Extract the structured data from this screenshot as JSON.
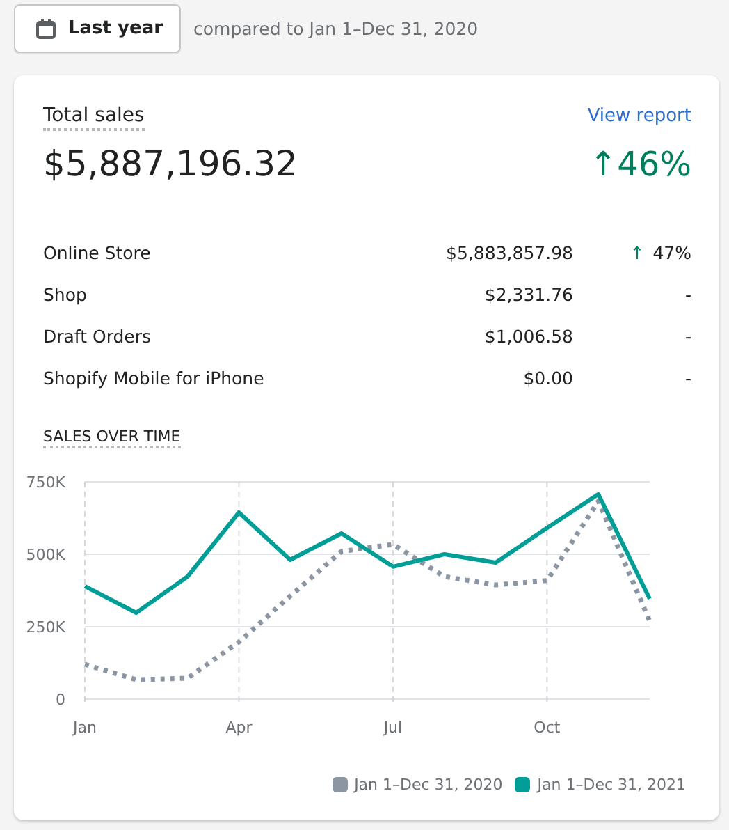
{
  "date_button": {
    "label": "Last year"
  },
  "comparison": "compared to Jan 1–Dec 31, 2020",
  "card": {
    "title": "Total sales",
    "link": "View report",
    "total": "$5,887,196.32",
    "change": {
      "arrow": "↑",
      "value": "46%"
    },
    "channels": [
      {
        "name": "Online Store",
        "amount": "$5,883,857.98",
        "arrow": "↑",
        "change": "47%"
      },
      {
        "name": "Shop",
        "amount": "$2,331.76",
        "change": "-"
      },
      {
        "name": "Draft Orders",
        "amount": "$1,006.58",
        "change": "-"
      },
      {
        "name": "Shopify Mobile for iPhone",
        "amount": "$0.00",
        "change": "-"
      }
    ],
    "chart_title": "SALES OVER TIME",
    "chart_data": {
      "type": "line",
      "categories": [
        "Jan",
        null,
        null,
        "Apr",
        null,
        null,
        "Jul",
        null,
        null,
        "Oct",
        null,
        null
      ],
      "grid": true,
      "yticks": [
        {
          "value": 0,
          "label": "0"
        },
        {
          "value": 250000,
          "label": "250K"
        },
        {
          "value": 500000,
          "label": "500K"
        },
        {
          "value": 750000,
          "label": "750K"
        }
      ],
      "ylim": [
        0,
        750000
      ],
      "series": [
        {
          "name": "Jan 1–Dec 31, 2020",
          "color": "#8c96a3",
          "line_style": "dotted",
          "values": [
            120000,
            67000,
            72000,
            197000,
            356000,
            510000,
            534000,
            423000,
            394000,
            409000,
            683000,
            269000
          ]
        },
        {
          "name": "Jan 1–Dec 31, 2021",
          "color": "#009e96",
          "line_style": "solid",
          "values": [
            390000,
            298000,
            423000,
            644000,
            481000,
            572000,
            457000,
            500000,
            471000,
            591000,
            707000,
            346000
          ]
        }
      ]
    }
  }
}
